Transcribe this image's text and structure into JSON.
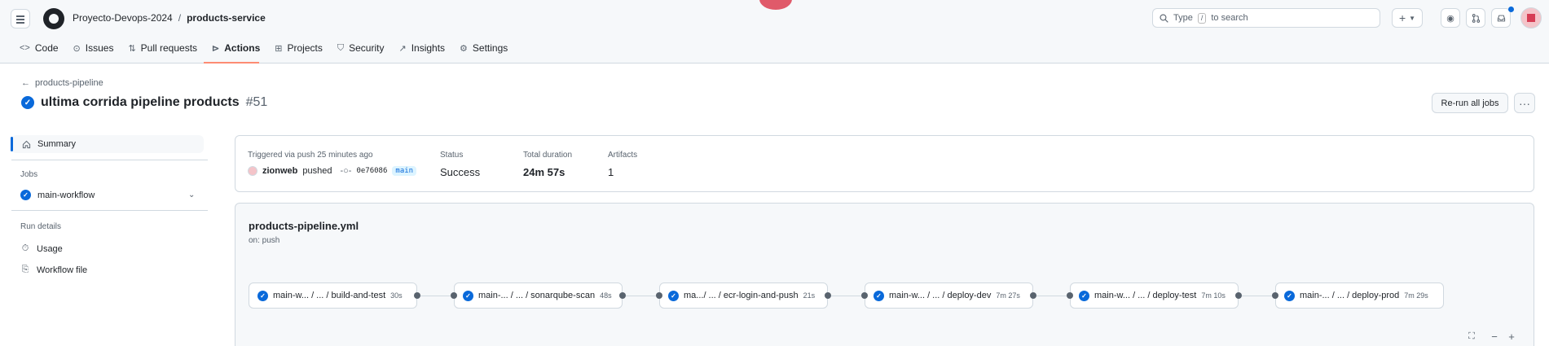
{
  "header": {
    "owner": "Proyecto-Devops-2024",
    "separator": "/",
    "repo": "products-service",
    "search_prefix": "Type",
    "search_key": "/",
    "search_suffix": "to search"
  },
  "tabs": [
    {
      "label": "Code",
      "icon": "code-icon"
    },
    {
      "label": "Issues",
      "icon": "issue-icon"
    },
    {
      "label": "Pull requests",
      "icon": "pull-request-icon"
    },
    {
      "label": "Actions",
      "icon": "play-icon"
    },
    {
      "label": "Projects",
      "icon": "table-icon"
    },
    {
      "label": "Security",
      "icon": "shield-icon"
    },
    {
      "label": "Insights",
      "icon": "graph-icon"
    },
    {
      "label": "Settings",
      "icon": "gear-icon"
    }
  ],
  "run": {
    "back_label": "products-pipeline",
    "title": "ultima corrida pipeline products",
    "number": "#51",
    "rerun_label": "Re-run all jobs"
  },
  "sidebar": {
    "summary_label": "Summary",
    "jobs_heading": "Jobs",
    "job_label": "main-workflow",
    "run_details_heading": "Run details",
    "usage_label": "Usage",
    "workflow_file_label": "Workflow file"
  },
  "summary": {
    "trigger_label": "Triggered via push 25 minutes ago",
    "user": "zionweb",
    "action": "pushed",
    "sha": "0e76086",
    "branch": "main",
    "status_label": "Status",
    "status_value": "Success",
    "duration_label": "Total duration",
    "duration_value": "24m 57s",
    "artifacts_label": "Artifacts",
    "artifacts_value": "1"
  },
  "workflow": {
    "file": "products-pipeline.yml",
    "trigger": "on: push",
    "jobs": [
      {
        "name": "main-w... / ... / build-and-test",
        "duration": "30s"
      },
      {
        "name": "main-... / ... / sonarqube-scan",
        "duration": "48s"
      },
      {
        "name": "ma.../ ... / ecr-login-and-push",
        "duration": "21s"
      },
      {
        "name": "main-w... / ... / deploy-dev",
        "duration": "7m 27s"
      },
      {
        "name": "main-w... / ... / deploy-test",
        "duration": "7m 10s"
      },
      {
        "name": "main-... / ... / deploy-prod",
        "duration": "7m 29s"
      }
    ]
  },
  "colors": {
    "accent": "#0969da",
    "tab_underline": "#fd8c73",
    "border": "#d1d9e0"
  }
}
